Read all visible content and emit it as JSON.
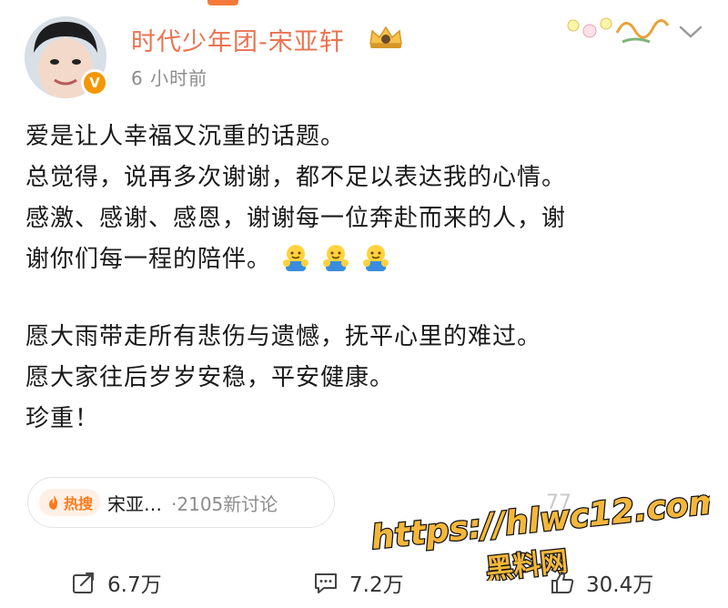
{
  "header": {
    "username": "时代少年团-宋亚轩",
    "timestamp": "6 小时前",
    "verified_badge": "V"
  },
  "post": {
    "lines": [
      "爱是让人幸福又沉重的话题。",
      "总觉得，说再多次谢谢，都不足以表达我的心情。",
      "感激、感谢、感恩，谢谢每一位奔赴而来的人，谢",
      "谢你们每一程的陪伴。",
      "愿大雨带走所有悲伤与遗憾，抚平心里的难过。",
      "愿大家往后岁岁安稳，平安健康。",
      "珍重！"
    ],
    "emoji": [
      "hug-emoji",
      "hug-emoji",
      "hug-emoji"
    ]
  },
  "hot_topic": {
    "badge": "热搜",
    "name": "宋亚…",
    "count": "·2105新讨论"
  },
  "faint_count": "77",
  "watermark": {
    "url": "https://hlwc12.com",
    "name": "黑料网"
  },
  "actions": {
    "repost": "6.7万",
    "comment": "7.2万",
    "like": "30.4万"
  },
  "colors": {
    "username": "#eb7350",
    "accent": "#f5793a",
    "hot_badge": "#ff7a1a",
    "watermark_fill": "#f4b73b"
  }
}
